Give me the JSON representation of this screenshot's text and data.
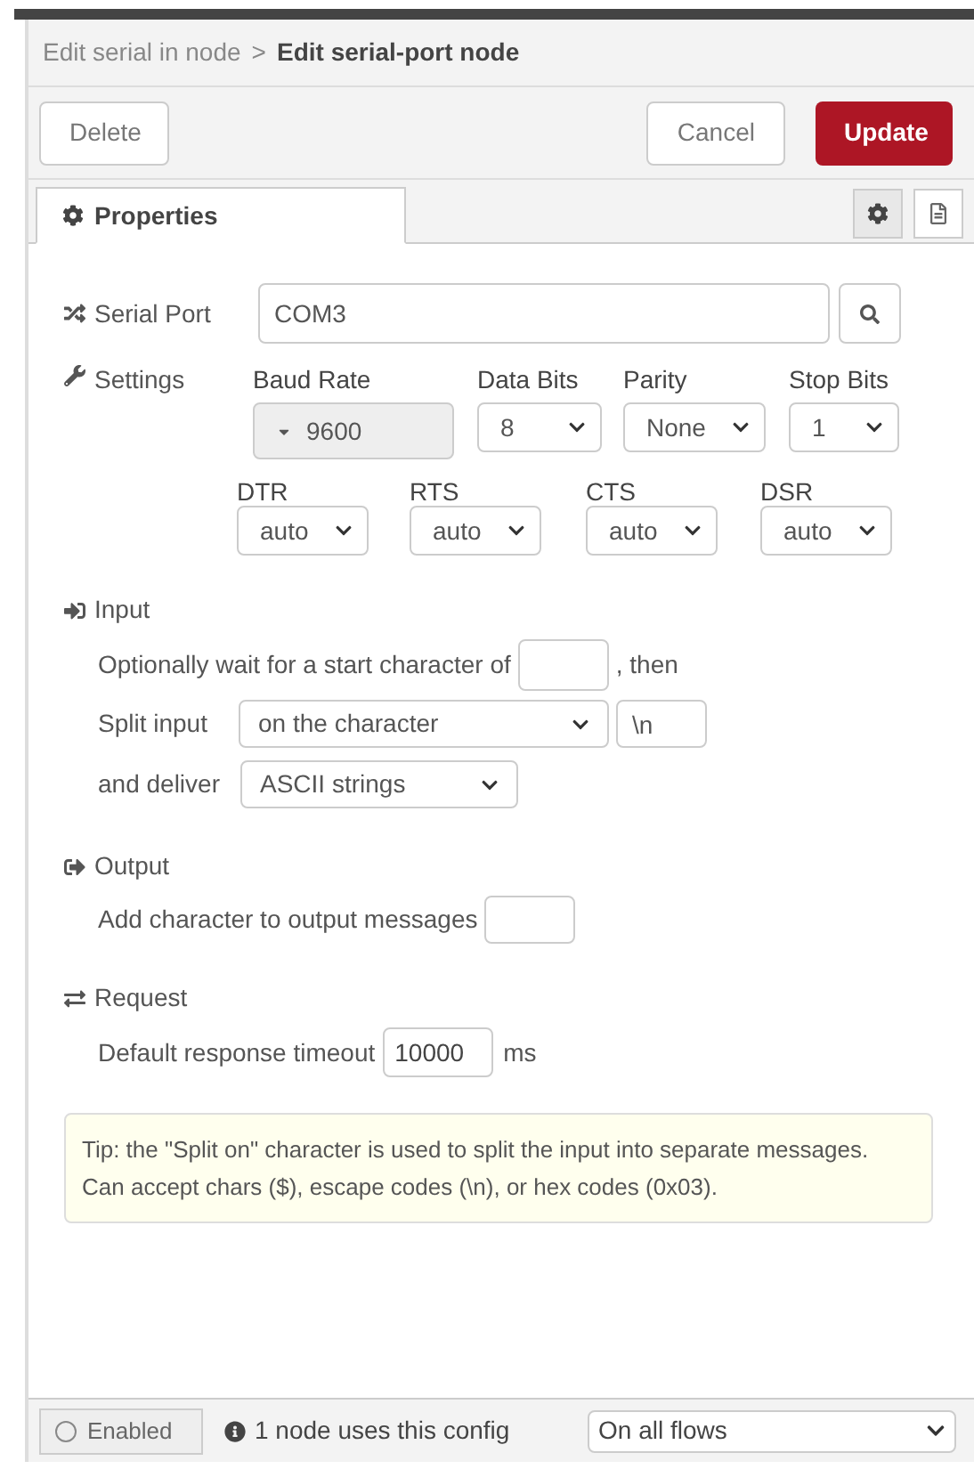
{
  "breadcrumb": {
    "parent": "Edit serial in node",
    "separator": ">",
    "current": "Edit serial-port node"
  },
  "buttons": [
    {
      "label": "Delete",
      "kind": "plain"
    },
    {
      "label": "Cancel",
      "kind": "plain"
    },
    {
      "label": "Update",
      "kind": "primary"
    }
  ],
  "tabs": [
    {
      "label": "Properties",
      "selected": true
    }
  ],
  "serial_port": {
    "label": "Serial Port",
    "value": "COM3"
  },
  "settings": {
    "label": "Settings",
    "row_1": [
      {
        "label": "Baud Rate",
        "value": "9600",
        "kind": "combo"
      },
      {
        "label": "Data Bits",
        "value": "8",
        "kind": "select"
      },
      {
        "label": "Parity",
        "value": "None",
        "kind": "select"
      },
      {
        "label": "Stop Bits",
        "value": "1",
        "kind": "select"
      }
    ],
    "row_2": [
      {
        "label": "DTR",
        "value": "auto",
        "kind": "select"
      },
      {
        "label": "RTS",
        "value": "auto",
        "kind": "select"
      },
      {
        "label": "CTS",
        "value": "auto",
        "kind": "select"
      },
      {
        "label": "DSR",
        "value": "auto",
        "kind": "select"
      }
    ]
  },
  "input": {
    "title": "Input",
    "wait_label": "Optionally wait for a start character of",
    "wait_suffix": ", then",
    "split_label": "Split input",
    "split_value": "on the character",
    "split_char": "\\n",
    "deliver_label": "and deliver",
    "deliver_value": "ASCII strings"
  },
  "output": {
    "title": "Output",
    "add_label": "Add character to output messages"
  },
  "request": {
    "title": "Request",
    "timeout_label": "Default response timeout",
    "timeout_value": "10000",
    "unit": "ms"
  },
  "tip": "Tip: the \"Split on\" character is used to split the input into separate messages. Can accept chars ($), escape codes (\\n), or hex codes (0x03).",
  "footer": {
    "enabled": {
      "label": "Enabled",
      "on": false
    },
    "usage": "1 node uses this config",
    "scope": "On all flows"
  }
}
